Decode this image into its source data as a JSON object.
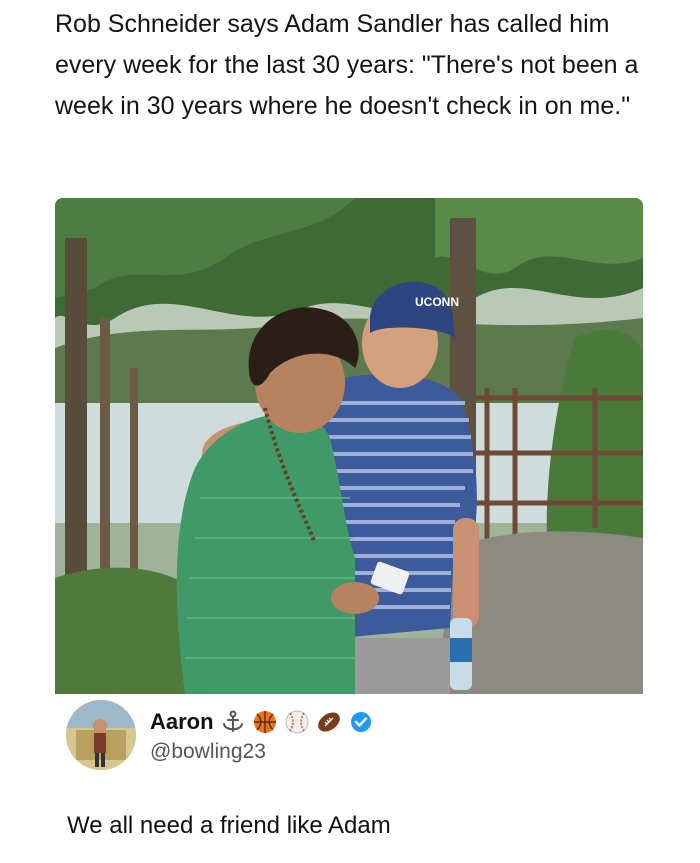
{
  "headline": "Rob Schneider says Adam Sandler has called him every week for the last 30 years: \"There's not been a week in 30 years where he doesn't check in on me.\"",
  "photo": {
    "icon": "photo-two-men-by-lake",
    "cap_text": "UCONN"
  },
  "tweet": {
    "author_name": "Aaron",
    "name_emojis": [
      "anchor-icon",
      "basketball-icon",
      "baseball-icon",
      "football-icon",
      "verified-badge-icon"
    ],
    "handle": "@bowling23",
    "text": "We all need a friend like Adam"
  },
  "colors": {
    "verified": "#1d9bf0",
    "text": "#111111",
    "handle": "#555555"
  }
}
